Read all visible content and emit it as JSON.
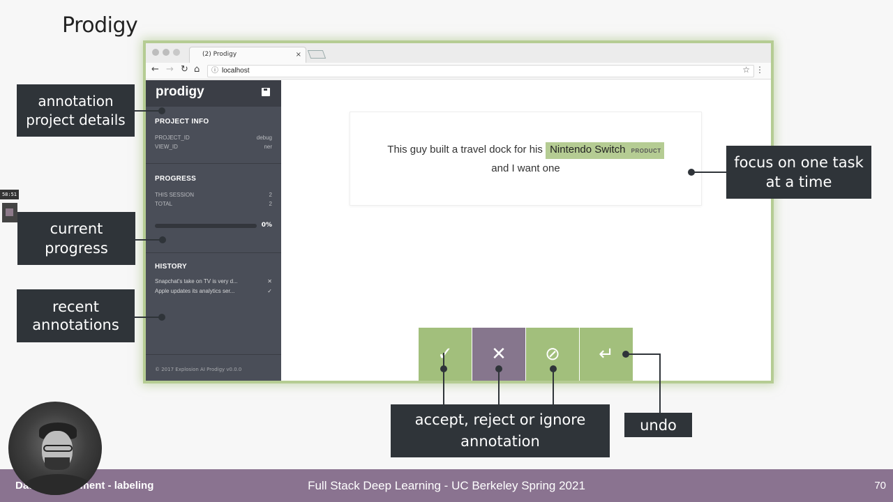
{
  "slide": {
    "title": "Prodigy",
    "footer_left": "Data Management - labeling",
    "footer_center": "Full Stack Deep Learning - UC Berkeley Spring 2021",
    "page_number": "70",
    "timer": "58:51"
  },
  "browser": {
    "tab_title": "(2) Prodigy",
    "tab_close": "×",
    "url": "localhost"
  },
  "prodigy": {
    "logo": "prodigy",
    "project_info": {
      "heading": "PROJECT INFO",
      "rows": [
        {
          "key": "PROJECT_ID",
          "value": "debug"
        },
        {
          "key": "VIEW_ID",
          "value": "ner"
        }
      ]
    },
    "progress": {
      "heading": "PROGRESS",
      "rows": [
        {
          "key": "THIS SESSION",
          "value": "2"
        },
        {
          "key": "TOTAL",
          "value": "2"
        }
      ],
      "percent_label": "0%",
      "percent_value": 0
    },
    "history": {
      "heading": "HISTORY",
      "items": [
        {
          "text": "Snapchat's take on TV is very d...",
          "status": "✕"
        },
        {
          "text": "Apple updates its analytics ser...",
          "status": "✓"
        }
      ]
    },
    "footer": "© 2017 Explosion AI   Prodigy v0.0.0"
  },
  "task": {
    "text_before": "This guy built a travel dock for his ",
    "entity": "Nintendo Switch",
    "entity_label": "PRODUCT",
    "text_after": "and I want one"
  },
  "actions": {
    "accept": "✓",
    "reject": "✕",
    "ignore": "⊘",
    "undo": "↵"
  },
  "callouts": {
    "project_details": "annotation project details",
    "current_progress": "current progress",
    "recent_annotations": "recent annotations",
    "focus": "focus on one task at a time",
    "actions": "accept, reject or ignore annotation",
    "undo": "undo"
  },
  "colors": {
    "accept": "#a2bf7c",
    "reject": "#86768d",
    "sidebar": "#4a4e58",
    "bottom_bar": "#8a7390"
  }
}
